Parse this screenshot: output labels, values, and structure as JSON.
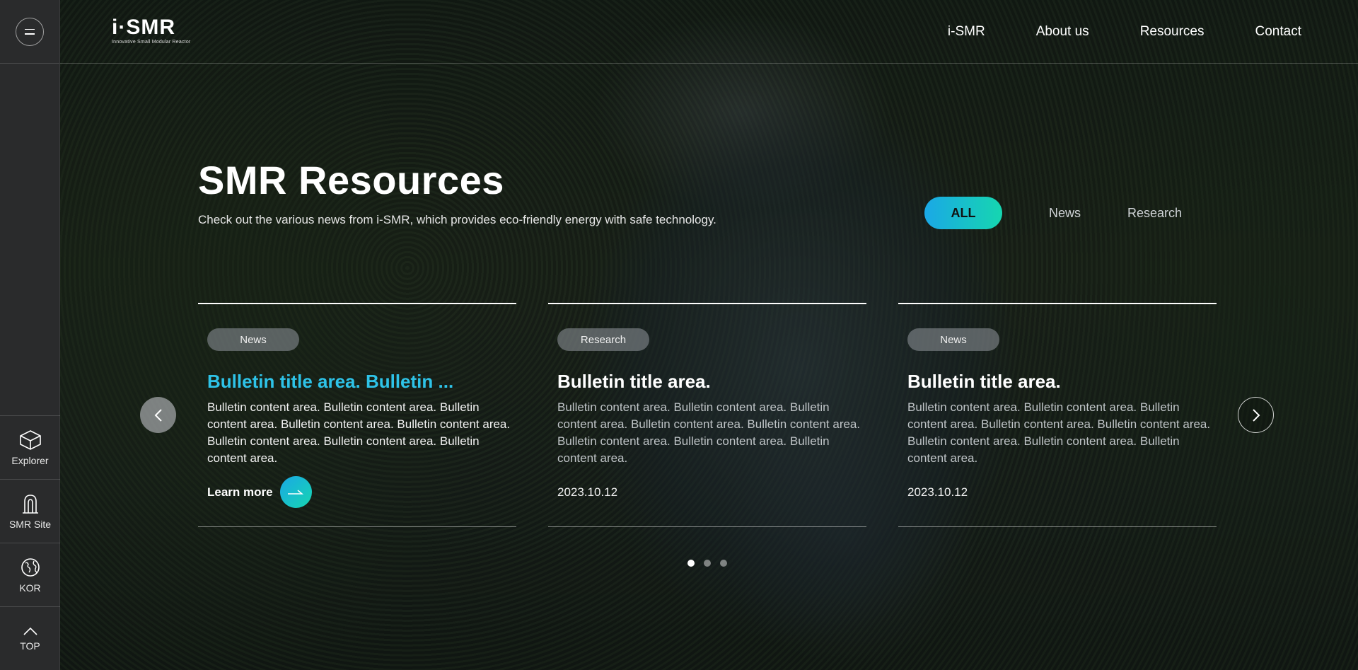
{
  "header": {
    "logo": {
      "main": "i·SMR",
      "sub": "Innovative Small Modular Reactor"
    },
    "nav": [
      "i-SMR",
      "About us",
      "Resources",
      "Contact"
    ]
  },
  "rail": {
    "items": [
      {
        "label": "Explorer",
        "icon": "cube-icon"
      },
      {
        "label": "SMR Site",
        "icon": "reactor-icon"
      },
      {
        "label": "KOR",
        "icon": "globe-icon"
      },
      {
        "label": "TOP",
        "icon": "chevron-up-icon"
      }
    ]
  },
  "hero": {
    "title": "SMR Resources",
    "subtitle": "Check out the various news from i-SMR, which provides eco-friendly energy with safe technology."
  },
  "filters": {
    "items": [
      "ALL",
      "News",
      "Research"
    ],
    "active": "ALL"
  },
  "cards": [
    {
      "tag": "News",
      "title": "Bulletin title area. Bulletin ...",
      "body": "Bulletin content area. Bulletin content area. Bulletin content area. Bulletin content area. Bulletin content area. Bulletin content area. Bulletin content area. Bulletin content area.",
      "cta": "Learn more",
      "active": true
    },
    {
      "tag": "Research",
      "title": "Bulletin title area.",
      "body": "Bulletin content area. Bulletin content area. Bulletin content area. Bulletin content area. Bulletin content area. Bulletin content area. Bulletin content area. Bulletin content area.",
      "date": "2023.10.12"
    },
    {
      "tag": "News",
      "title": "Bulletin title area.",
      "body": "Bulletin content area. Bulletin content area. Bulletin content area. Bulletin content area. Bulletin content area. Bulletin content area. Bulletin content area. Bulletin content area.",
      "date": "2023.10.12"
    }
  ],
  "carousel": {
    "pages": 3,
    "current": 1
  },
  "colors": {
    "accent_start": "#1aa8e6",
    "accent_end": "#16d6b0",
    "highlight_title": "#2ec3e8",
    "rail_bg": "#2a2b2c"
  }
}
